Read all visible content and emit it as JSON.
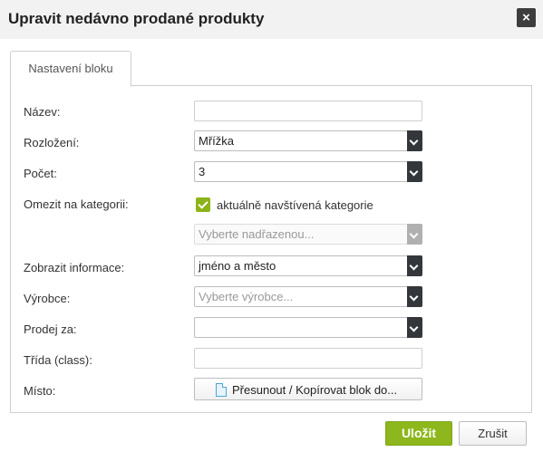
{
  "dialog": {
    "title": "Upravit nedávno prodané produkty",
    "close_label": "×"
  },
  "tabs": [
    {
      "label": "Nastavení bloku"
    }
  ],
  "form": {
    "name": {
      "label": "Název:",
      "value": ""
    },
    "layout": {
      "label": "Rozložení:",
      "value": "Mřížka"
    },
    "count": {
      "label": "Počet:",
      "value": "3"
    },
    "category": {
      "label": "Omezit na kategorii:",
      "checkbox_label": "aktuálně navštívená kategorie",
      "checked": true,
      "parent_placeholder": "Vyberte nadřazenou..."
    },
    "info": {
      "label": "Zobrazit informace:",
      "value": "jméno a město"
    },
    "manufacturer": {
      "label": "Výrobce:",
      "placeholder": "Vyberte výrobce..."
    },
    "sell_for": {
      "label": "Prodej za:",
      "value": ""
    },
    "css_class": {
      "label": "Třída (class):",
      "value": ""
    },
    "place": {
      "label": "Místo:",
      "button_label": "Přesunout / Kopírovat blok do..."
    }
  },
  "footer": {
    "save_label": "Uložit",
    "cancel_label": "Zrušit"
  },
  "icons": {
    "close": "close-icon",
    "document": "document-icon",
    "dropdown": "chevron-down-icon",
    "check": "checkmark-icon"
  },
  "colors": {
    "accent_green": "#8db71c",
    "dropdown_arrow_bg": "#33373b",
    "close_bg": "#3d3d3d"
  }
}
